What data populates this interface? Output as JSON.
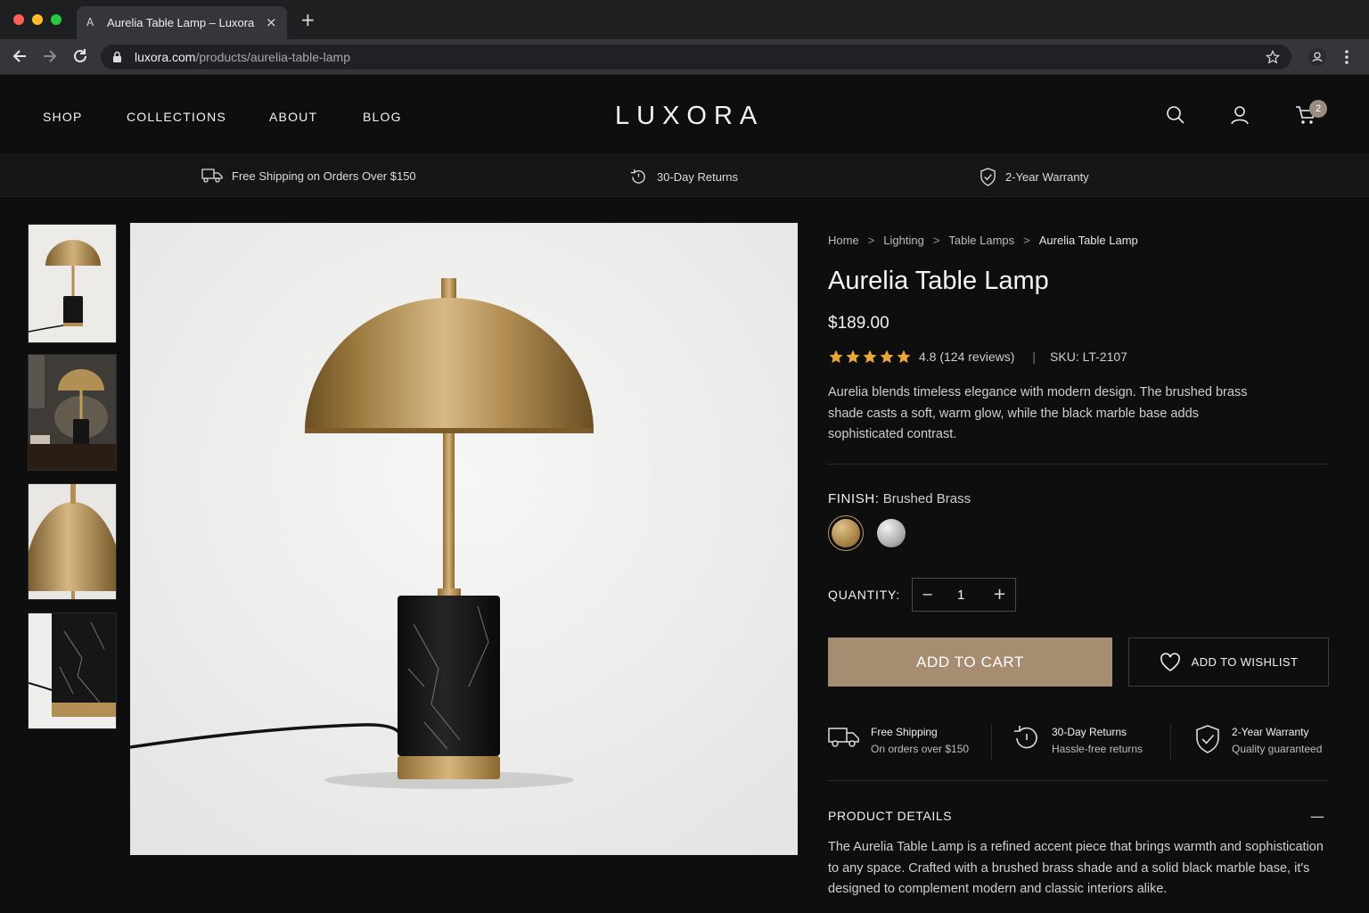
{
  "browser": {
    "tab_title": "Aurelia Table Lamp – Luxora",
    "tab_favicon": "A",
    "tab_close": "×",
    "new_tab": "+",
    "url_host": "luxora.com",
    "url_path": "/products/aurelia-table-lamp",
    "icons": [
      "back-icon",
      "forward-icon",
      "reload-icon",
      "lock-icon",
      "star-icon",
      "profile-icon",
      "menu-icon"
    ]
  },
  "header": {
    "nav": [
      "SHOP",
      "COLLECTIONS",
      "ABOUT",
      "BLOG"
    ],
    "logo": "LUXORA",
    "cart_count": "2",
    "icons": [
      "search-icon",
      "account-icon",
      "cart-icon"
    ]
  },
  "benefit_bar": {
    "shipping": "Free Shipping on Orders Over $150",
    "returns": "30-Day Returns",
    "warranty": "2-Year Warranty"
  },
  "gallery": {
    "thumbnails": [
      "lamp-front",
      "lamp-on-table",
      "shade-closeup",
      "marble-base-closeup"
    ],
    "active_index": 0
  },
  "product": {
    "breadcrumb": [
      "Home",
      "Lighting",
      "Table Lamps",
      "Aurelia Table Lamp"
    ],
    "breadcrumb_sep": ">",
    "title": "Aurelia Table Lamp",
    "price": "$189.00",
    "rating_value": 4.8,
    "rating_text": "4.8 (124 reviews)",
    "rating_divider": "|",
    "sku": "SKU: LT-2107",
    "description": "Aurelia blends timeless elegance with modern design. The brushed brass shade casts a soft, warm glow, while the black marble base adds sophisticated contrast.",
    "finish_label": "FINISH:",
    "finish_value": "Brushed Brass",
    "finish_options": [
      "Brushed Brass",
      "Chrome"
    ],
    "quantity_label": "QUANTITY:",
    "qty_minus": "−",
    "quantity": "1",
    "qty_plus": "+",
    "add_to_cart": "ADD TO CART",
    "add_to_wishlist": "ADD TO WISHLIST",
    "features": [
      {
        "title": "Free Shipping",
        "sub": "On orders over $150",
        "icon": "truck-icon"
      },
      {
        "title": "30-Day Returns",
        "sub": "Hassle-free returns",
        "icon": "returns-icon"
      },
      {
        "title": "2-Year Warranty",
        "sub": "Quality guaranteed",
        "icon": "shield-icon"
      }
    ],
    "details_title": "PRODUCT DETAILS",
    "details_toggle": "—",
    "details_text": "The Aurelia Table Lamp is a refined accent piece that brings warmth and sophistication to any space. Crafted with a brushed brass shade and a solid black marble base, it's designed to complement modern and classic interiors alike."
  },
  "colors": {
    "accent": "#a68d71",
    "background": "#0e0e0f",
    "star": "#e8a93a"
  }
}
